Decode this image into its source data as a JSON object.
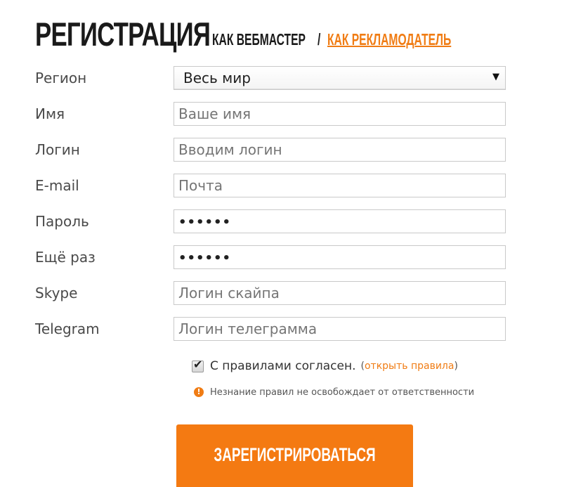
{
  "header": {
    "title": "РЕГИСТРАЦИЯ",
    "role_current": "КАК ВЕБМАСТЕР",
    "role_separator": "/",
    "role_alternative": "КАК РЕКЛАМОДАТЕЛЬ"
  },
  "form": {
    "region": {
      "label": "Регион",
      "value": "Весь мир",
      "arrow": "▼"
    },
    "name": {
      "label": "Имя",
      "placeholder": "Ваше имя"
    },
    "login": {
      "label": "Логин",
      "placeholder": "Вводим логин"
    },
    "email": {
      "label": "E-mail",
      "placeholder": "Почта"
    },
    "password": {
      "label": "Пароль",
      "value": "••••••"
    },
    "password_repeat": {
      "label": "Ещё раз",
      "value": "••••••"
    },
    "skype": {
      "label": "Skype",
      "placeholder": "Логин скайпа"
    },
    "telegram": {
      "label": "Telegram",
      "placeholder": "Логин телеграмма"
    }
  },
  "agreement": {
    "checked": true,
    "check_glyph": "✔",
    "text": "С правилами согласен.",
    "open_prefix": "(",
    "open_link": "открыть правила",
    "open_suffix": ")"
  },
  "notice": {
    "icon": "!",
    "text": "Незнание правил не освобождает от ответственности"
  },
  "submit": {
    "label": "ЗАРЕГИСТРИРОВАТЬСЯ"
  },
  "colors": {
    "accent": "#f47a12",
    "link": "#f07c14",
    "text": "#333333",
    "field_border": "#c9c9c9"
  }
}
